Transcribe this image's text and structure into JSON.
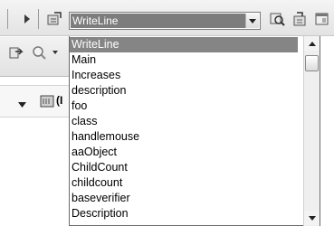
{
  "toolbar": {
    "icons": [
      "play-icon",
      "method-icon",
      "find-icon",
      "properties-icon",
      "window-icon"
    ]
  },
  "method_combo": {
    "selected_value": "WriteLine"
  },
  "left_panel": {
    "partial_label": "(I"
  },
  "dropdown": {
    "items": [
      "WriteLine",
      "Main",
      "Increases",
      "description",
      "foo",
      "class",
      "handlemouse",
      "aaObject",
      "ChildCount",
      "childcount",
      "baseverifier",
      "Description"
    ],
    "selected_index": 0,
    "scroll_position": 0.05
  },
  "colors": {
    "selection": "#858585",
    "toolbar": "#e8e8e8",
    "border": "#6b6b6b"
  }
}
